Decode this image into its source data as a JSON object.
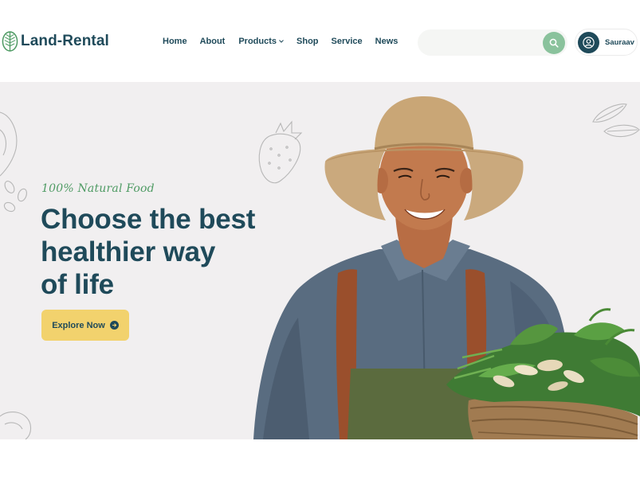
{
  "brand": {
    "name": "Land-Rental",
    "icon": "leaf-icon",
    "color": "#1f4a5a"
  },
  "nav": {
    "items": [
      {
        "label": "Home"
      },
      {
        "label": "About"
      },
      {
        "label": "Products",
        "has_dropdown": true
      },
      {
        "label": "Shop"
      },
      {
        "label": "Service"
      },
      {
        "label": "News"
      }
    ]
  },
  "search": {
    "value": "",
    "placeholder": "",
    "icon": "search-icon",
    "button_color": "#8ac29c"
  },
  "user": {
    "name": "Sauraav",
    "icon": "user-icon"
  },
  "hero": {
    "tagline": "100% Natural Food",
    "headline_lines": [
      "Choose the best",
      "healthier way",
      "of life"
    ],
    "cta_label": "Explore Now",
    "cta_icon": "arrow-right-icon",
    "cta_color": "#f2d26d",
    "background": "#f1eff0",
    "image": "farmer-with-vegetable-basket"
  },
  "colors": {
    "accent_green": "#4f9b64",
    "dark_teal": "#1f4a5a"
  }
}
